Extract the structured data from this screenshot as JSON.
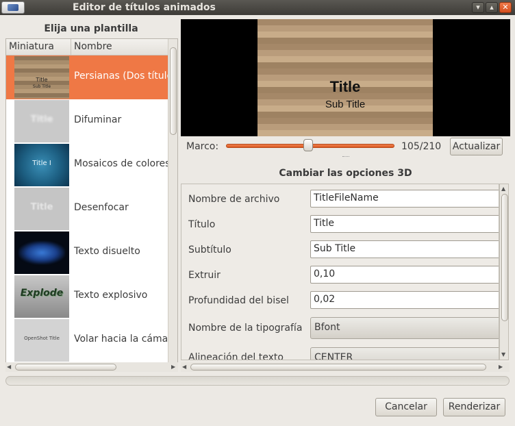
{
  "window": {
    "title": "Editor de títulos animados",
    "controls": [
      "minimize",
      "maximize",
      "close"
    ]
  },
  "templates": {
    "heading": "Elija una plantilla",
    "columns": [
      "Miniatura",
      "Nombre"
    ],
    "items": [
      {
        "name": "Persianas (Dos títulos)",
        "thumb": "blinds",
        "thumb_title": "Title",
        "thumb_sub": "Sub Title",
        "selected": true
      },
      {
        "name": "Difuminar",
        "thumb": "blur",
        "thumb_title": "Title"
      },
      {
        "name": "Mosaicos de colores",
        "thumb": "mosaic",
        "thumb_title": "Title I"
      },
      {
        "name": "Desenfocar",
        "thumb": "unfocus",
        "thumb_title": "Title"
      },
      {
        "name": "Texto disuelto",
        "thumb": "dissolve",
        "thumb_title": ""
      },
      {
        "name": "Texto explosivo",
        "thumb": "explode",
        "thumb_title": "Explode"
      },
      {
        "name": "Volar hacia la cámara",
        "thumb": "fly",
        "thumb_title": "OpenShot Title"
      }
    ]
  },
  "preview": {
    "title": "Title",
    "subtitle": "Sub Title"
  },
  "frame": {
    "label": "Marco:",
    "value": "105/210",
    "progress": 0.5,
    "update_button": "Actualizar"
  },
  "options": {
    "heading": "Cambiar las opciones 3D",
    "fields": [
      {
        "label": "Nombre de archivo",
        "value": "TitleFileName",
        "type": "text"
      },
      {
        "label": "Título",
        "value": "Title",
        "type": "text"
      },
      {
        "label": "Subtítulo",
        "value": "Sub Title",
        "type": "text"
      },
      {
        "label": "Extruir",
        "value": "0,10",
        "type": "text"
      },
      {
        "label": "Profundidad del bisel",
        "value": "0,02",
        "type": "text"
      },
      {
        "label": "Nombre de la tipografía",
        "value": "Bfont",
        "type": "select"
      },
      {
        "label": "Alineación del texto",
        "value": "CENTER",
        "type": "select"
      }
    ]
  },
  "footer": {
    "cancel": "Cancelar",
    "render": "Renderizar"
  },
  "colors": {
    "accent": "#ef7845",
    "titlebar": "#3d3b37"
  }
}
